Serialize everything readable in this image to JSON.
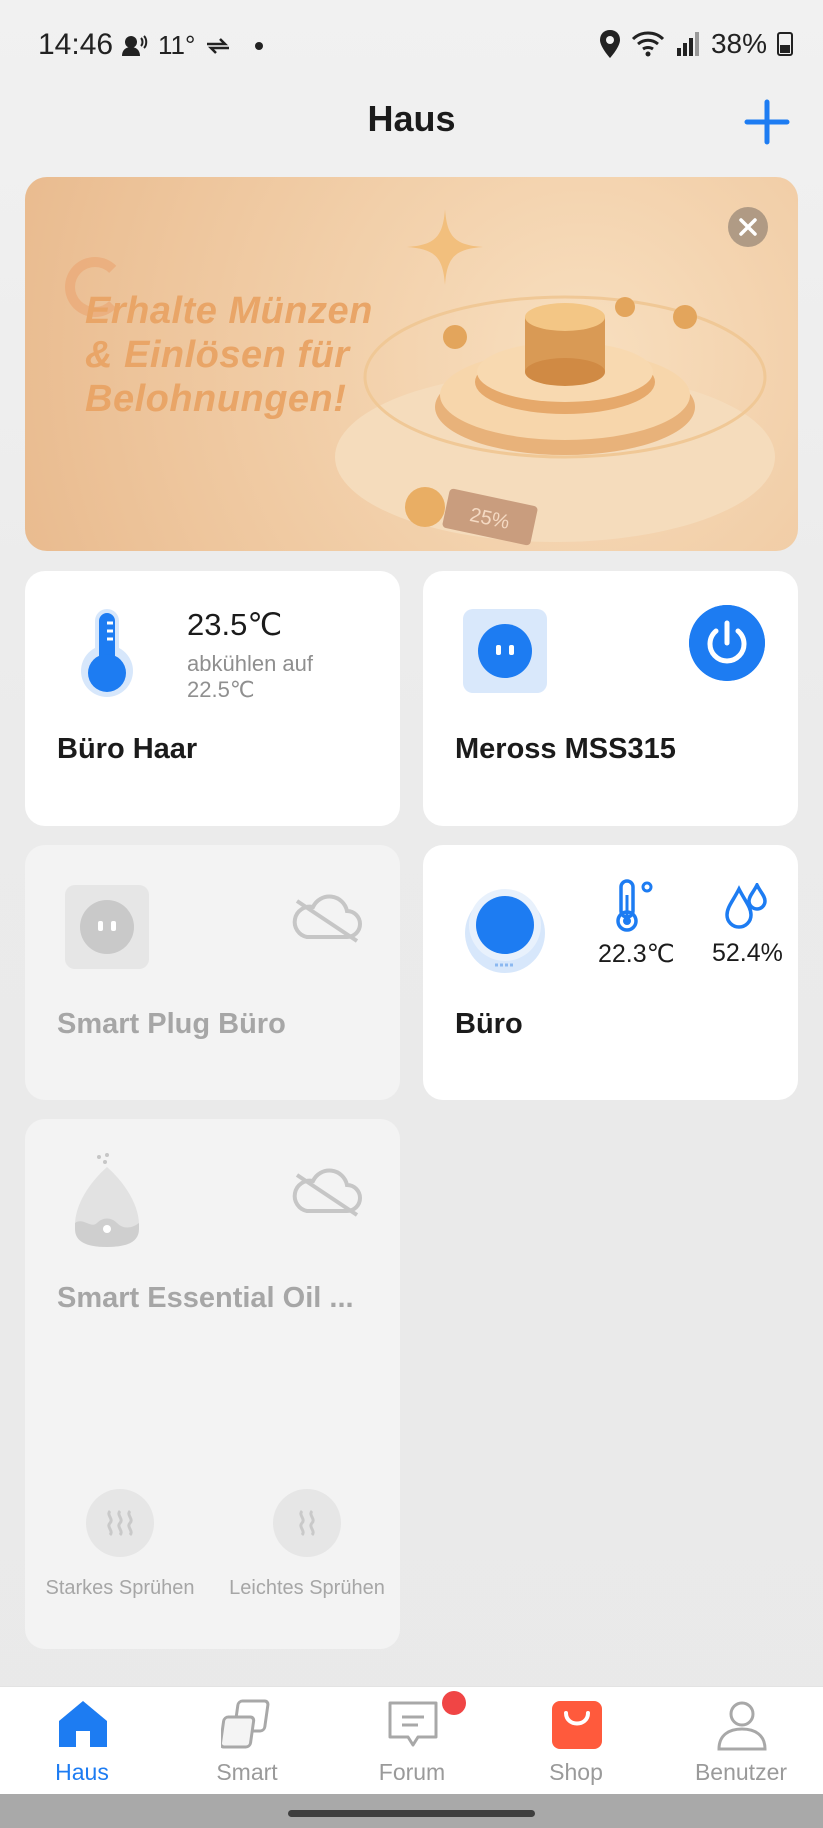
{
  "status_bar": {
    "time": "14:46",
    "temperature": "11°",
    "battery": "38%"
  },
  "header": {
    "title": "Haus"
  },
  "banner": {
    "text_line1": "Erhalte Münzen",
    "text_line2": "& Einlösen für",
    "text_line3": "Belohnungen!",
    "tag": "25%"
  },
  "devices": {
    "buero_haar": {
      "name": "Büro Haar",
      "temperature": "23.5℃",
      "status_line1": "abkühlen auf",
      "status_line2": "22.5℃"
    },
    "meross": {
      "name": "Meross MSS315"
    },
    "smart_plug": {
      "name": "Smart Plug Büro"
    },
    "buero_sensor": {
      "name": "Büro",
      "temperature": "22.3℃",
      "humidity": "52.4%"
    },
    "oil": {
      "name": "Smart Essential Oil ...",
      "action1": "Starkes Sprühen",
      "action2": "Leichtes Sprühen"
    }
  },
  "nav": {
    "items": [
      "Haus",
      "Smart",
      "Forum",
      "Shop",
      "Benutzer"
    ]
  },
  "colors": {
    "accent": "#1d7cf2",
    "badge": "#f04545",
    "shop": "#ff5a3c"
  }
}
